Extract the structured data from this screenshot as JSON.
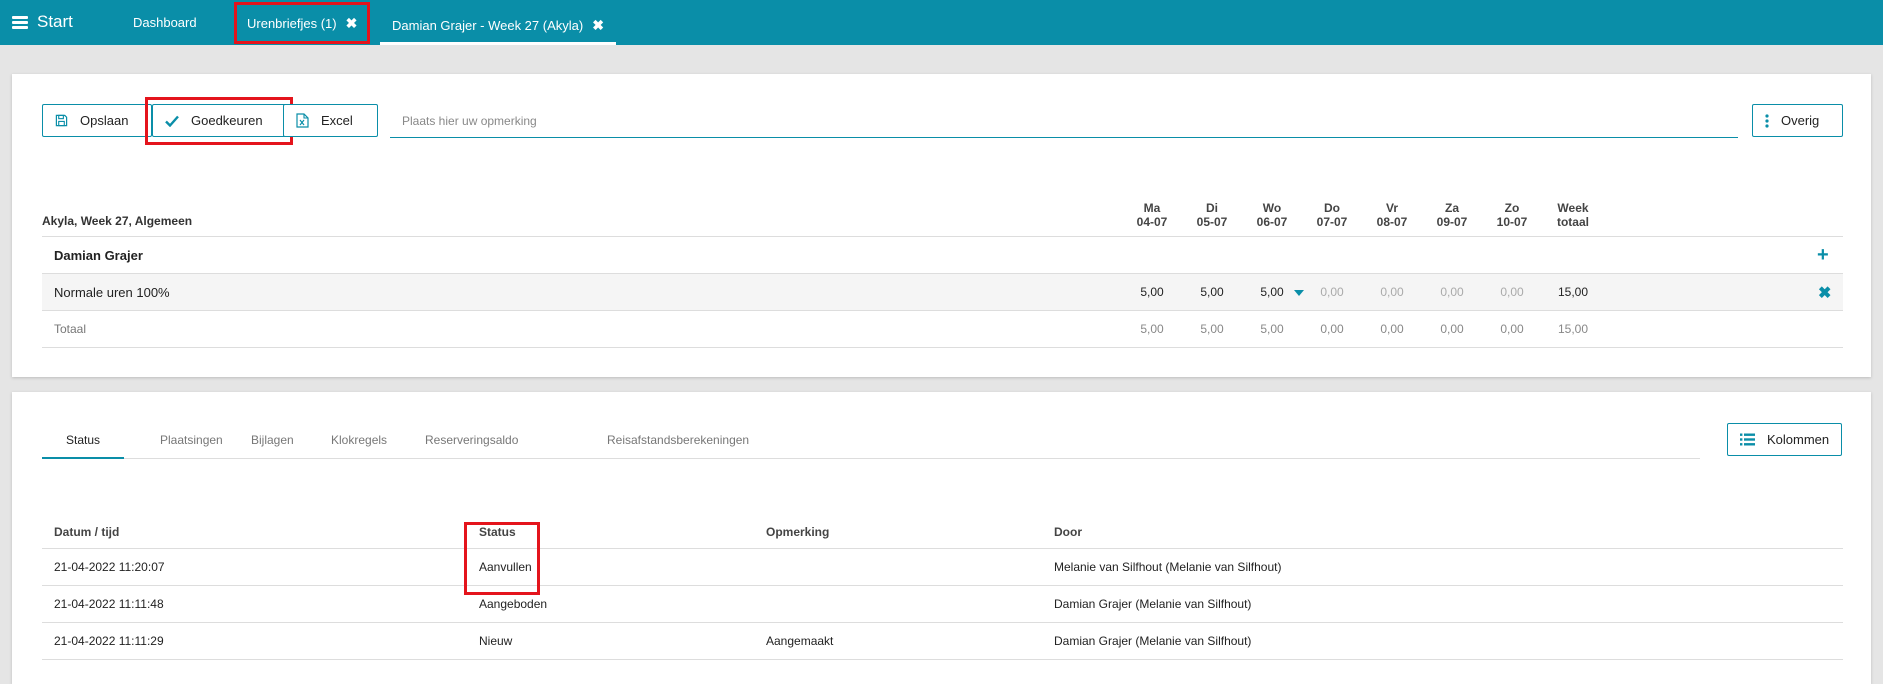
{
  "topbar": {
    "menu_label": "Start",
    "tabs": [
      {
        "label": "Dashboard"
      },
      {
        "label": "Urenbriefjes (1)",
        "close": "✖"
      },
      {
        "label": "Damian Grajer - Week 27 (Akyla)",
        "close": "✖"
      }
    ],
    "color": "#0a8ea8"
  },
  "toolbar": {
    "save_label": "Opslaan",
    "approve_label": "Goedkeuren",
    "excel_label": "Excel",
    "remark_placeholder": "Plaats hier uw opmerking",
    "other_label": "Overig"
  },
  "hours": {
    "title": "Akyla, Week 27, Algemeen",
    "days": [
      {
        "day": "Ma",
        "date": "04-07"
      },
      {
        "day": "Di",
        "date": "05-07"
      },
      {
        "day": "Wo",
        "date": "06-07"
      },
      {
        "day": "Do",
        "date": "07-07"
      },
      {
        "day": "Vr",
        "date": "08-07"
      },
      {
        "day": "Za",
        "date": "09-07"
      },
      {
        "day": "Zo",
        "date": "10-07"
      }
    ],
    "week_total_label": [
      "Week",
      "totaal"
    ],
    "employee": "Damian Grajer",
    "rows": [
      {
        "label": "Normale uren 100%",
        "values": [
          "5,00",
          "5,00",
          "5,00",
          "0,00",
          "0,00",
          "0,00",
          "0,00"
        ],
        "total": "15,00"
      }
    ],
    "totals": {
      "label": "Totaal",
      "values": [
        "5,00",
        "5,00",
        "5,00",
        "0,00",
        "0,00",
        "0,00",
        "0,00"
      ],
      "total": "15,00"
    }
  },
  "detail": {
    "tabs": [
      "Status",
      "Plaatsingen",
      "Bijlagen",
      "Klokregels",
      "Reserveringsaldo",
      "Reisafstandsberekeningen"
    ],
    "columns_button": "Kolommen",
    "table": {
      "headers": [
        "Datum / tijd",
        "Status",
        "Opmerking",
        "Door"
      ],
      "rows": [
        [
          "21-04-2022 11:20:07",
          "Aanvullen",
          "",
          "Melanie van Silfhout (Melanie van Silfhout)"
        ],
        [
          "21-04-2022 11:11:48",
          "Aangeboden",
          "",
          "Damian Grajer (Melanie van Silfhout)"
        ],
        [
          "21-04-2022 11:11:29",
          "Nieuw",
          "Aangemaakt",
          "Damian Grajer (Melanie van Silfhout)"
        ]
      ]
    }
  },
  "icons": [
    "hamburger-icon",
    "close-icon",
    "save-icon",
    "check-icon",
    "excel-icon",
    "more-vertical-icon",
    "plus-icon",
    "dropdown-caret-icon",
    "list-icon"
  ]
}
